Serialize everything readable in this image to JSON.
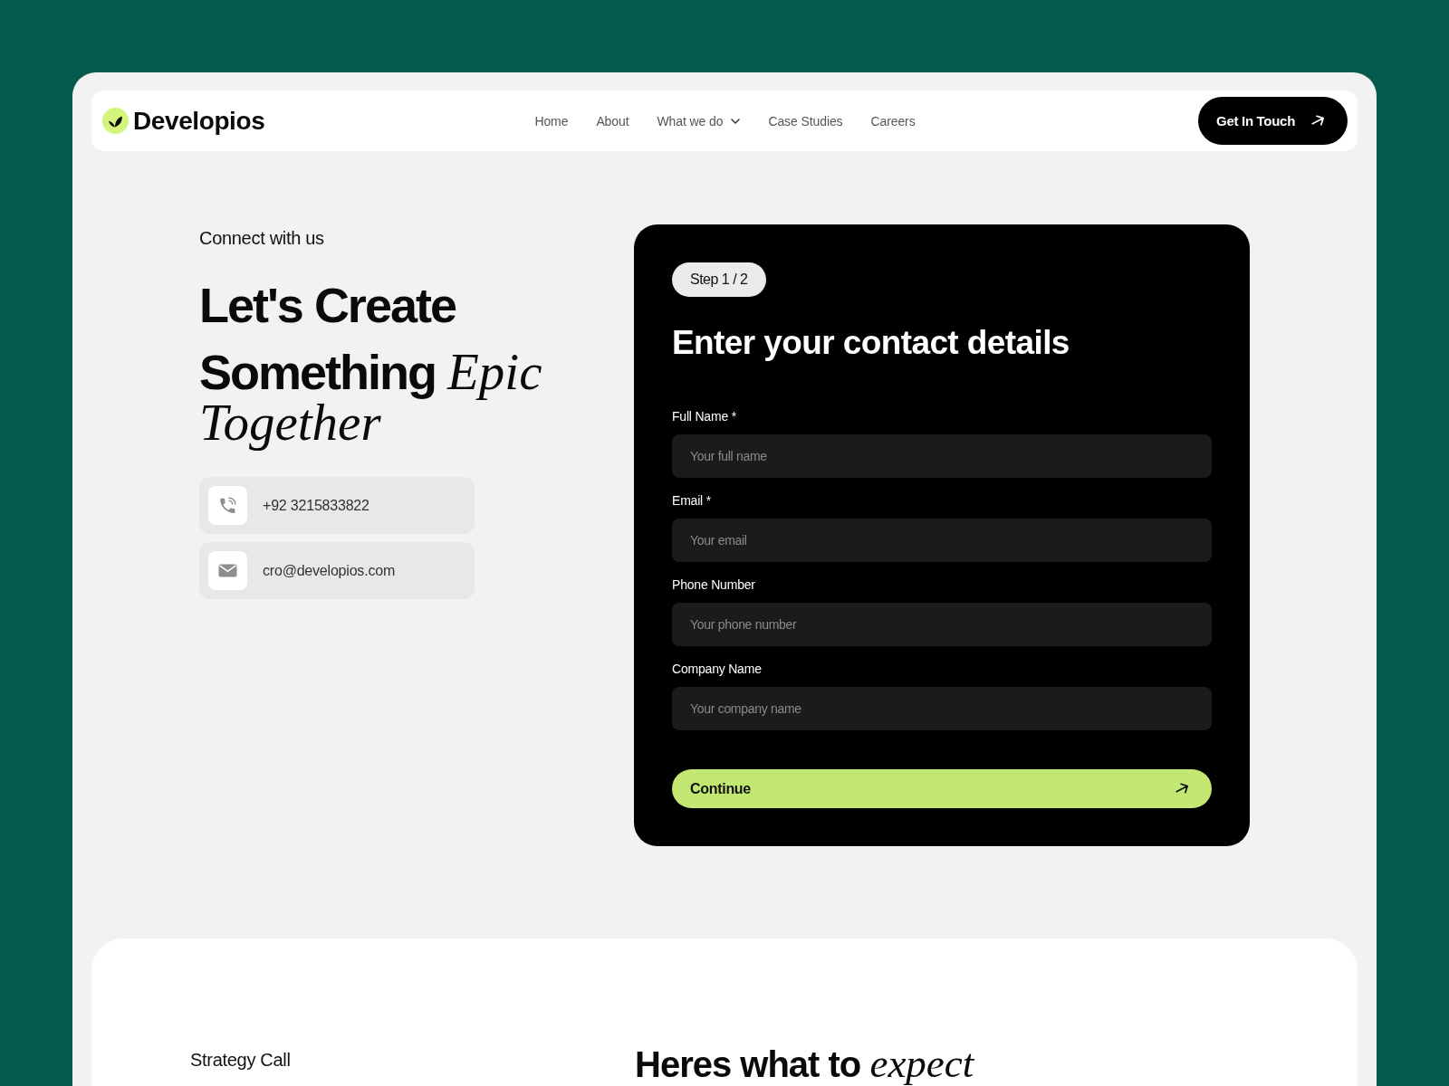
{
  "nav": {
    "logo": "Developios",
    "links": [
      {
        "label": "Home",
        "dropdown": false
      },
      {
        "label": "About",
        "dropdown": false
      },
      {
        "label": "What we do",
        "dropdown": true
      },
      {
        "label": "Case Studies",
        "dropdown": false
      },
      {
        "label": "Careers",
        "dropdown": false
      }
    ],
    "cta": "Get In Touch"
  },
  "hero": {
    "eyebrow": "Connect with us",
    "headline": [
      "Let's Create",
      "Something *Epic Together*"
    ],
    "contacts": [
      {
        "kind": "phone",
        "text": "+92 3215833822"
      },
      {
        "kind": "email",
        "text": "cro@developios.com"
      }
    ]
  },
  "form": {
    "step": "Step 1 / 2",
    "title": "Enter your contact details",
    "fields": [
      {
        "label": "Full Name *",
        "placeholder": "Your full name"
      },
      {
        "label": "Email *",
        "placeholder": "Your email"
      },
      {
        "label": "Phone Number",
        "placeholder": "Your phone number"
      },
      {
        "label": "Company Name",
        "placeholder": "Your company name"
      }
    ],
    "submit": "Continue"
  },
  "next_section": {
    "eyebrow": "Strategy Call",
    "title": "Heres what to *expect*"
  }
}
